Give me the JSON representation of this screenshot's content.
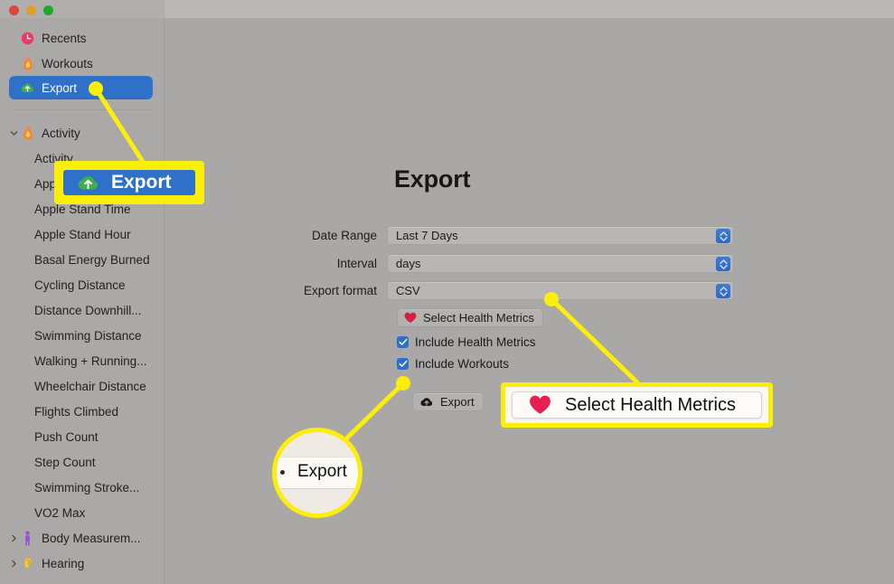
{
  "window": {
    "traffic_lights": [
      {
        "name": "close",
        "color": "#e0443e"
      },
      {
        "name": "minimize",
        "color": "#dea123"
      },
      {
        "name": "maximize",
        "color": "#1aab29"
      }
    ]
  },
  "sidebar": {
    "top_items": [
      {
        "label": "Recents",
        "icon": "clock-icon",
        "selected": false
      },
      {
        "label": "Workouts",
        "icon": "flame-icon",
        "selected": false
      },
      {
        "label": "Export",
        "icon": "cloud-upload-icon",
        "selected": true
      }
    ],
    "groups": [
      {
        "label": "Activity",
        "icon": "flame-icon",
        "expanded": true,
        "twisty": "chevron-down-icon",
        "children": [
          "Activity",
          "Apple Exercise Time",
          "Apple Stand Time",
          "Apple Stand Hour",
          "Basal Energy Burned",
          "Cycling Distance",
          "Distance Downhill...",
          "Swimming Distance",
          "Walking + Running...",
          "Wheelchair Distance",
          "Flights Climbed",
          "Push Count",
          "Step Count",
          "Swimming Stroke...",
          "VO2 Max"
        ]
      },
      {
        "label": "Body Measurem...",
        "icon": "body-icon",
        "expanded": false,
        "twisty": "chevron-right-icon",
        "children": []
      },
      {
        "label": "Hearing",
        "icon": "ear-icon",
        "expanded": false,
        "twisty": "chevron-right-icon",
        "children": []
      }
    ]
  },
  "main": {
    "title": "Export",
    "fields": [
      {
        "label": "Date Range",
        "value": "Last 7 Days",
        "control": "combo-box"
      },
      {
        "label": "Interval",
        "value": "days",
        "control": "combo-box"
      },
      {
        "label": "Export format",
        "value": "CSV",
        "control": "combo-box"
      }
    ],
    "select_metrics_button": {
      "label": "Select Health Metrics",
      "icon": "heart-icon"
    },
    "checkboxes": [
      {
        "label": "Include Health Metrics",
        "checked": true
      },
      {
        "label": "Include Workouts",
        "checked": true
      }
    ],
    "export_button": {
      "label": "Export",
      "icon": "cloud-upload-icon"
    }
  },
  "annotations": {
    "highlight_color": "#fbee0a",
    "callouts": [
      {
        "name": "sidebar-export-callout",
        "label": "Export",
        "icon": "cloud-upload-icon",
        "style": "blue-row-zoom"
      },
      {
        "name": "select-health-metrics-callout",
        "label": "Select Health Metrics",
        "icon": "heart-icon",
        "style": "light-button-zoom"
      },
      {
        "name": "export-button-callout",
        "label": "Export",
        "style": "circle-zoom"
      }
    ]
  }
}
